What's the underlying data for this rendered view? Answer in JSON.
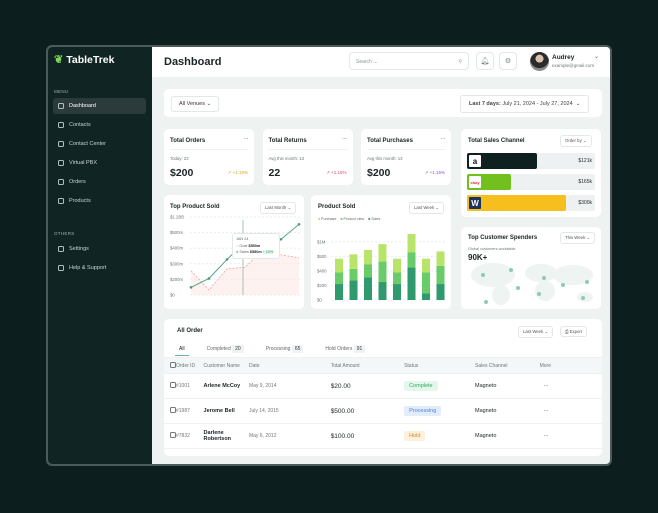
{
  "app": {
    "name": "TableTrek"
  },
  "sidebar": {
    "menu_label": "MENU",
    "others_label": "OTHERS",
    "items": [
      {
        "label": "Dashboard",
        "icon": "grid-icon",
        "active": true
      },
      {
        "label": "Contacts",
        "icon": "contacts-icon"
      },
      {
        "label": "Contact Center",
        "icon": "user-circle-icon"
      },
      {
        "label": "Virtual PBX",
        "icon": "wallet-icon"
      },
      {
        "label": "Orders",
        "icon": "orders-icon"
      },
      {
        "label": "Products",
        "icon": "products-icon"
      }
    ],
    "others": [
      {
        "label": "Settings",
        "icon": "gear-icon"
      },
      {
        "label": "Help & Support",
        "icon": "help-icon"
      }
    ]
  },
  "header": {
    "title": "Dashboard",
    "search_placeholder": "Search ...",
    "user_name": "Audrey",
    "user_email": "example@gmail.com"
  },
  "filters": {
    "venues": "All Venues",
    "date_prefix": "Last 7 days:",
    "date_range": "July 21, 2024 - July 27, 2024"
  },
  "stats": [
    {
      "title": "Total Orders",
      "sub": "Today: 22",
      "value": "$200",
      "change": "+1.15%",
      "color": "#d9a520"
    },
    {
      "title": "Total Returns",
      "sub": "Avg this month: 13",
      "value": "22",
      "change": "+1.15%",
      "color": "#e0457b"
    },
    {
      "title": "Total Purchases",
      "sub": "Avg this month: 13",
      "value": "$200",
      "change": "+1.15%",
      "color": "#8a4fd8"
    }
  ],
  "sales_channel": {
    "title": "Total Sales Channel",
    "order_by": "Order by",
    "channels": [
      {
        "name": "amazon",
        "logo": "a",
        "value": "$121k",
        "fill": 0.55,
        "color": "#0f2020"
      },
      {
        "name": "ebay",
        "logo": "ebay",
        "value": "$165k",
        "fill": 0.34,
        "color": "#72c01e"
      },
      {
        "name": "walmart",
        "logo": "W",
        "value": "$300k",
        "fill": 0.77,
        "color": "#f7bf1e"
      }
    ]
  },
  "top_customers": {
    "title": "Top Customer Spenders",
    "period": "This Week",
    "sub": "Global customers worldwide",
    "value": "90K+"
  },
  "chart_data": [
    {
      "type": "line",
      "title": "Top Product Sold",
      "period": "Last Month",
      "yticks": [
        "$0",
        "$200m",
        "$300m",
        "$400m",
        "$500m",
        "$1.2BB"
      ],
      "ytick_values": [
        0,
        200,
        300,
        400,
        500,
        1200
      ],
      "series": [
        {
          "name": "Goal",
          "values": [
            255,
            64,
            268,
            277,
            389,
            357,
            339
          ],
          "color": "#f0a0a0"
        },
        {
          "name": "Sales",
          "values": [
            98,
            206,
            328,
            438,
            450,
            457,
            872
          ],
          "color": "#4a9a7a"
        }
      ],
      "tooltip": {
        "label": "JAN 24",
        "goal": "$550m",
        "sales": "$580m",
        "sales_change": "↑ 10%"
      }
    },
    {
      "type": "bar",
      "stacked": true,
      "title": "Product Sold",
      "period": "Last Week",
      "yticks": [
        "$0",
        "$200",
        "$400",
        "$500",
        "$1M"
      ],
      "ylim": [
        0,
        800
      ],
      "series": [
        {
          "name": "Sales",
          "values": [
            220,
            270,
            310,
            250,
            220,
            450,
            90,
            220
          ],
          "color": "#2e9a6e"
        },
        {
          "name": "Product view",
          "values": [
            160,
            160,
            180,
            280,
            160,
            210,
            290,
            250
          ],
          "color": "#6acb6a"
        },
        {
          "name": "Purchase",
          "values": [
            190,
            200,
            200,
            240,
            190,
            250,
            190,
            200
          ],
          "color": "#b8e46a"
        }
      ],
      "legend": [
        "Purchase",
        "Product view",
        "Sales"
      ]
    }
  ],
  "orders": {
    "title": "All Order",
    "period": "Last Week",
    "export": "Export",
    "tabs": [
      {
        "label": "All",
        "count": ""
      },
      {
        "label": "Completed",
        "count": "20"
      },
      {
        "label": "Processing",
        "count": "65"
      },
      {
        "label": "Hold Orders",
        "count": "91"
      }
    ],
    "columns": [
      "Order ID",
      "Customer Name",
      "Date",
      "Total Amount",
      "Status",
      "Sales Channel",
      "More"
    ],
    "rows": [
      {
        "id": "#1001",
        "name": "Arlene McCoy",
        "date": "May 9, 2014",
        "amount": "$20.00",
        "status": "Complete",
        "channel": "Magneto"
      },
      {
        "id": "#1987",
        "name": "Jerome Bell",
        "date": "July 14, 2015",
        "amount": "$500.00",
        "status": "Processing",
        "channel": "Magneto"
      },
      {
        "id": "#7832",
        "name": "Darlene Robertson",
        "date": "May 6, 2012",
        "amount": "$100.00",
        "status": "Hold",
        "channel": "Magneto"
      }
    ]
  }
}
